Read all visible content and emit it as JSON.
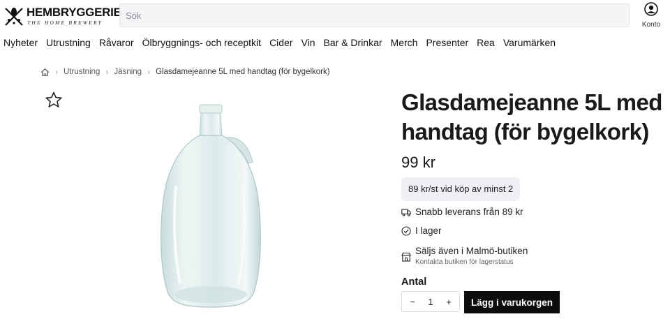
{
  "brand": {
    "name": "HEMBRYGGERIET",
    "tagline": "THE HOME BREWERY"
  },
  "search": {
    "placeholder": "Sök",
    "value": ""
  },
  "account": {
    "label": "Konto",
    "icon": "user-circle-icon"
  },
  "nav": {
    "items": [
      "Nyheter",
      "Utrustning",
      "Råvaror",
      "Ölbryggnings- och receptkit",
      "Cider",
      "Vin",
      "Bar & Drinkar",
      "Merch",
      "Presenter",
      "Rea",
      "Varumärken"
    ]
  },
  "breadcrumb": {
    "home_icon": "home-icon",
    "items": [
      "Utrustning",
      "Jäsning"
    ],
    "current": "Glasdamejeanne 5L med handtag (för bygelkork)"
  },
  "product": {
    "title": "Glasdamejeanne 5L med handtag (för bygelkork)",
    "price": "99 kr",
    "bulk_offer": "89 kr/st vid köp av minst 2",
    "delivery": "Snabb leverans från 89 kr",
    "stock": "I lager",
    "store": "Säljs även i Malmö-butiken",
    "store_sub": "Kontakta butiken för lagerstatus",
    "quantity_label": "Antal",
    "quantity": "1",
    "decrement": "−",
    "increment": "+",
    "add_to_cart": "Lägg i varukorgen",
    "favorite_icon": "star-outline-icon"
  },
  "colors": {
    "button_bg": "#0d0d0d",
    "offer_bg": "#eef0f3",
    "search_bg": "#f4f5f7"
  }
}
